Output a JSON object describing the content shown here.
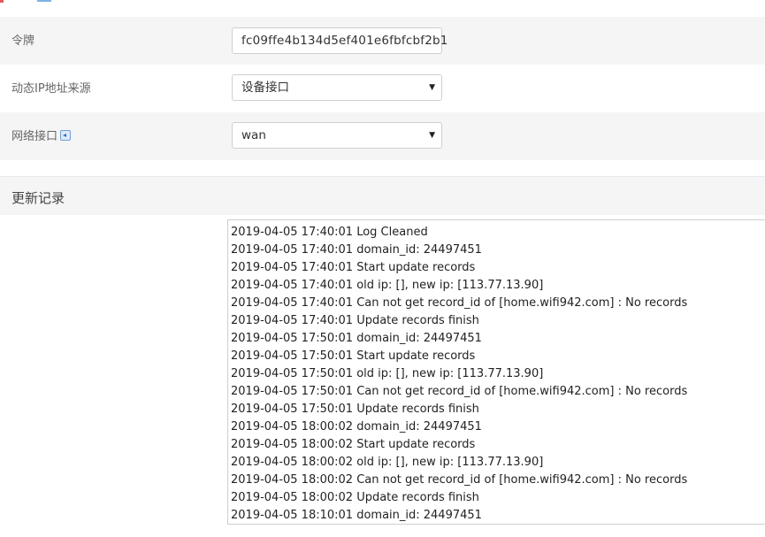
{
  "form": {
    "token_label": "令牌",
    "token_value": "fc09ffe4b134d5ef401e6fbfcbf2b1",
    "ip_source_label": "动态IP地址来源",
    "ip_source_value": "设备接口",
    "interface_label": "网络接口",
    "interface_value": "wan"
  },
  "log": {
    "title": "更新记录",
    "lines": [
      "2019-04-05 17:40:01 Log Cleaned",
      "2019-04-05 17:40:01 domain_id: 24497451",
      "2019-04-05 17:40:01 Start update records",
      "2019-04-05 17:40:01 old ip: [], new ip: [113.77.13.90]",
      "2019-04-05 17:40:01 Can not get record_id of [home.wifi942.com] : No records",
      "2019-04-05 17:40:01 Update records finish",
      "2019-04-05 17:50:01 domain_id: 24497451",
      "2019-04-05 17:50:01 Start update records",
      "2019-04-05 17:50:01 old ip: [], new ip: [113.77.13.90]",
      "2019-04-05 17:50:01 Can not get record_id of [home.wifi942.com] : No records",
      "2019-04-05 17:50:01 Update records finish",
      "2019-04-05 18:00:02 domain_id: 24497451",
      "2019-04-05 18:00:02 Start update records",
      "2019-04-05 18:00:02 old ip: [], new ip: [113.77.13.90]",
      "2019-04-05 18:00:02 Can not get record_id of [home.wifi942.com] : No records",
      "2019-04-05 18:00:02 Update records finish",
      "2019-04-05 18:10:01 domain_id: 24497451"
    ]
  },
  "icons": {
    "interface_help": "info-icon",
    "select_arrow": "chevron-down-icon"
  },
  "colors": {
    "row_background": "#f5f5f5",
    "field_border": "#cfcfcf",
    "icon_blue": "#2f6fbf"
  }
}
